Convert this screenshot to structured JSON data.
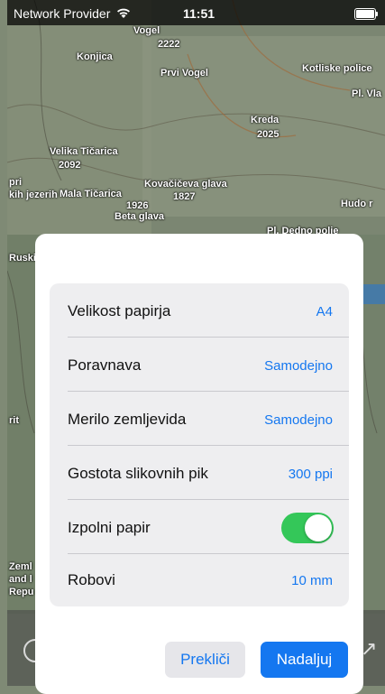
{
  "status_bar": {
    "carrier": "Network Provider",
    "time": "11:51"
  },
  "map_labels": {
    "vogel": "Vogel",
    "rocky": "2222",
    "konjica": "Konjica",
    "prvi_vogel": "Prvi Vogel",
    "kotlisk": "Kotliske police",
    "pl_vla": "Pl. Vla",
    "kreda": "Kreda",
    "kreda_alt": "2025",
    "velika": "Velika Tičarica",
    "velika_alt": "2092",
    "kovacic": "Kovačičeva glava",
    "kovacic_alt": "1827",
    "jezerih": "pri",
    "jezerih2": "kih jezerih",
    "mala": "Mala Tičarica",
    "beta_alt": "1926",
    "beta": "Beta glava",
    "hudo": "Hudo r",
    "pl_dedno": "Pl. Dedno polje",
    "ruski": "Ruski",
    "rit": "rit",
    "zemlj": "Zeml",
    "zemlj2": "and l",
    "zemlj3": "Repu"
  },
  "dialog": {
    "rows": [
      {
        "label": "Velikost papirja",
        "value": "A4"
      },
      {
        "label": "Poravnava",
        "value": "Samodejno"
      },
      {
        "label": "Merilo zemljevida",
        "value": "Samodejno"
      },
      {
        "label": "Gostota slikovnih pik",
        "value": "300 ppi"
      },
      {
        "label": "Izpolni papir",
        "toggle": true
      },
      {
        "label": "Robovi",
        "value": "10 mm"
      }
    ],
    "cancel_label": "Prekliči",
    "continue_label": "Nadaljuj"
  },
  "colors": {
    "accent": "#1477f0",
    "toggle_on": "#34c759"
  }
}
